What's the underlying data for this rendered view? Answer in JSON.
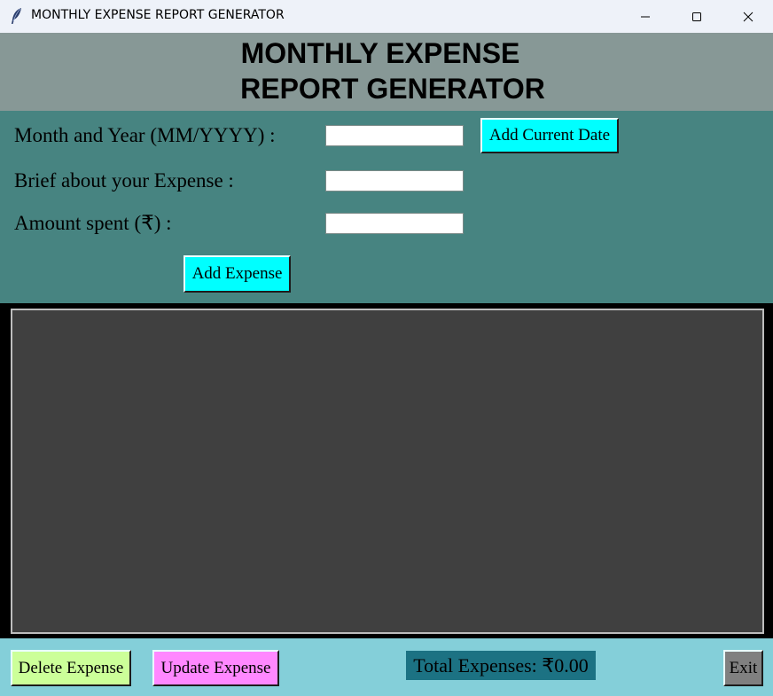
{
  "window": {
    "title": "MONTHLY EXPENSE REPORT GENERATOR",
    "app_icon": "feather-icon",
    "controls": [
      "minimize-icon",
      "maximize-icon",
      "close-icon"
    ]
  },
  "header": {
    "line1": "MONTHLY EXPENSE",
    "line2": "REPORT GENERATOR",
    "background": "#879896"
  },
  "form": {
    "background": "#478481",
    "month_label": "Month and Year (MM/YYYY) :",
    "month_value": "",
    "brief_label": "Brief about your Expense :",
    "brief_value": "",
    "amount_label": "Amount spent (₹) :",
    "amount_value": "",
    "add_current_date_label": "Add Current Date",
    "add_expense_label": "Add Expense",
    "button_color": "#00ffff"
  },
  "expense_list": {
    "items": [],
    "background": "#404040"
  },
  "footer": {
    "background": "#84cfd9",
    "delete_label": "Delete Expense",
    "delete_color": "#ccff99",
    "update_label": "Update Expense",
    "update_color": "#ff88ff",
    "total_text": "Total Expenses: ₹0.00",
    "total_color": "#1c7283",
    "exit_label": "Exit",
    "exit_color": "#808080"
  }
}
